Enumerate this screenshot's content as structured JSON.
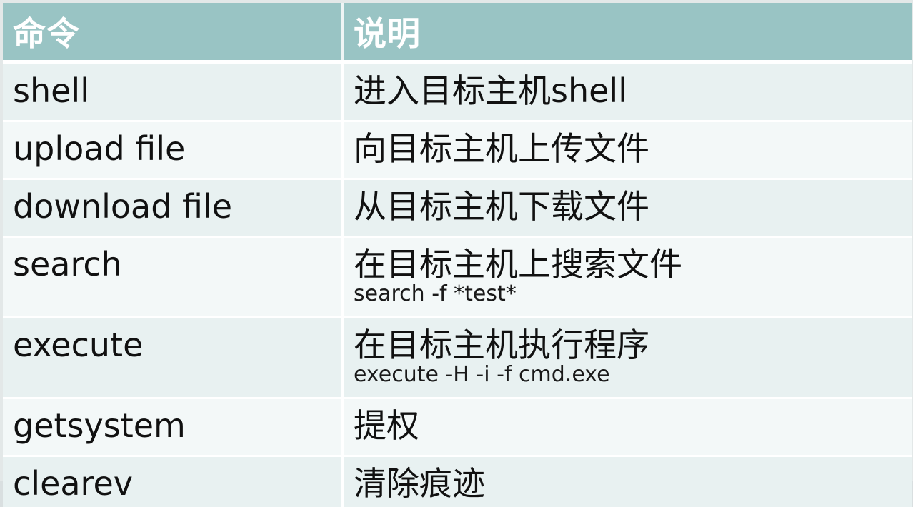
{
  "table": {
    "headers": [
      "命令",
      "说明"
    ],
    "rows": [
      {
        "command": "shell",
        "description": "进入目标主机shell",
        "example": ""
      },
      {
        "command": "upload file",
        "description": "向目标主机上传文件",
        "example": ""
      },
      {
        "command": "download file",
        "description": "从目标主机下载文件",
        "example": ""
      },
      {
        "command": "search",
        "description": "在目标主机上搜索文件",
        "example": "search -f *test*"
      },
      {
        "command": "execute",
        "description": "在目标主机执行程序",
        "example": "execute -H -i -f cmd.exe"
      },
      {
        "command": "getsystem",
        "description": "提权",
        "example": ""
      },
      {
        "command": "clearev",
        "description": "清除痕迹",
        "example": ""
      }
    ]
  },
  "colors": {
    "header_bg": "#99c4c4",
    "row_bg_odd": "#e8f1f1",
    "row_bg_even": "#f3f8f8",
    "text": "#111111"
  }
}
